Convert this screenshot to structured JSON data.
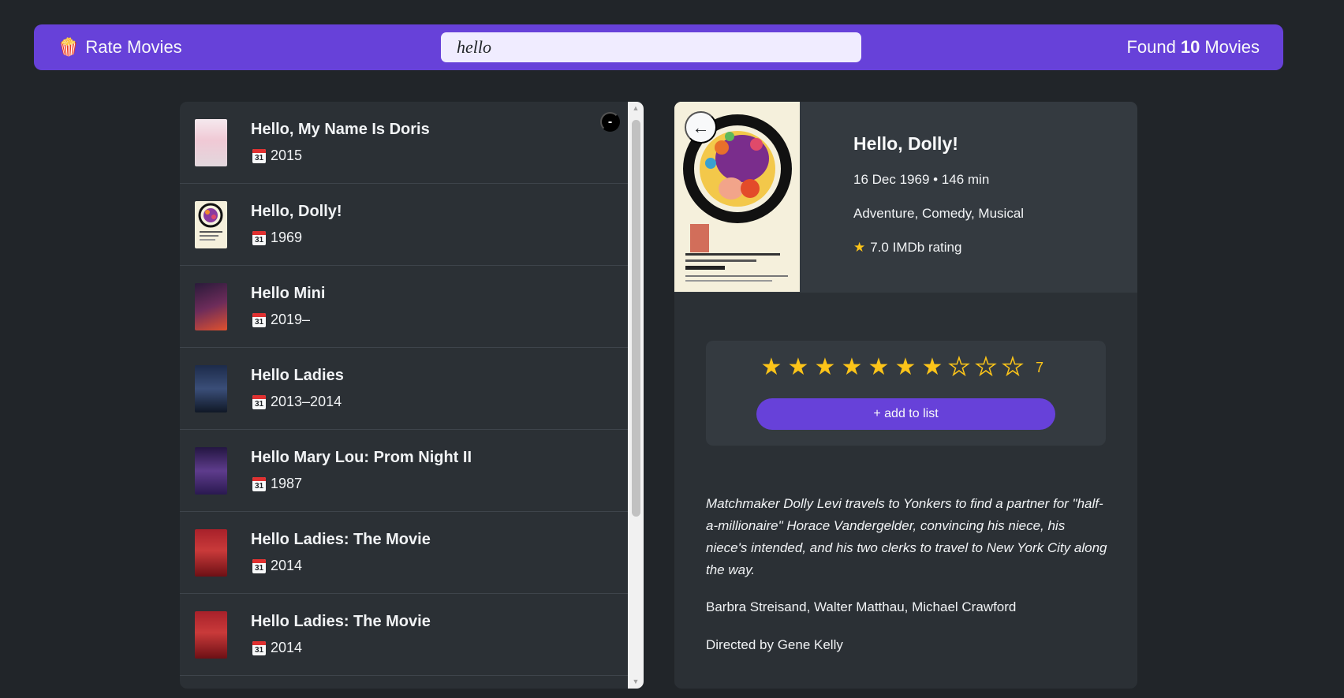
{
  "nav": {
    "logo_icon": "🍿",
    "logo_text": "Rate Movies",
    "search_value": "hello",
    "results_prefix": "Found",
    "results_count": "10",
    "results_suffix": "Movies"
  },
  "list": {
    "toggle_label": "-",
    "movies": [
      {
        "title": "Hello, My Name Is Doris",
        "year": "2015"
      },
      {
        "title": "Hello, Dolly!",
        "year": "1969"
      },
      {
        "title": "Hello Mini",
        "year": "2019–"
      },
      {
        "title": "Hello Ladies",
        "year": "2013–2014"
      },
      {
        "title": "Hello Mary Lou: Prom Night II",
        "year": "1987"
      },
      {
        "title": "Hello Ladies: The Movie",
        "year": "2014"
      },
      {
        "title": "Hello Ladies: The Movie",
        "year": "2014"
      }
    ],
    "calendar_icon_text": "31"
  },
  "detail": {
    "back_label": "←",
    "title": "Hello, Dolly!",
    "released_runtime": "16 Dec 1969 • 146 min",
    "genre": "Adventure, Comedy, Musical",
    "imdb_rating": "7.0 IMDb rating",
    "user_rating": 7,
    "max_rating": 10,
    "rating_label": "7",
    "add_button_label": "+ add to list",
    "plot": "Matchmaker Dolly Levi travels to Yonkers to find a partner for \"half-a-millionaire\" Horace Vandergelder, convincing his niece, his niece's intended, and his two clerks to travel to New York City along the way.",
    "actors": "Barbra Streisand, Walter Matthau, Michael Crawford",
    "director": "Directed by Gene Kelly"
  },
  "colors": {
    "accent": "#6741d9",
    "background": "#212529",
    "panel": "#2b3035",
    "star": "#fcc419"
  }
}
